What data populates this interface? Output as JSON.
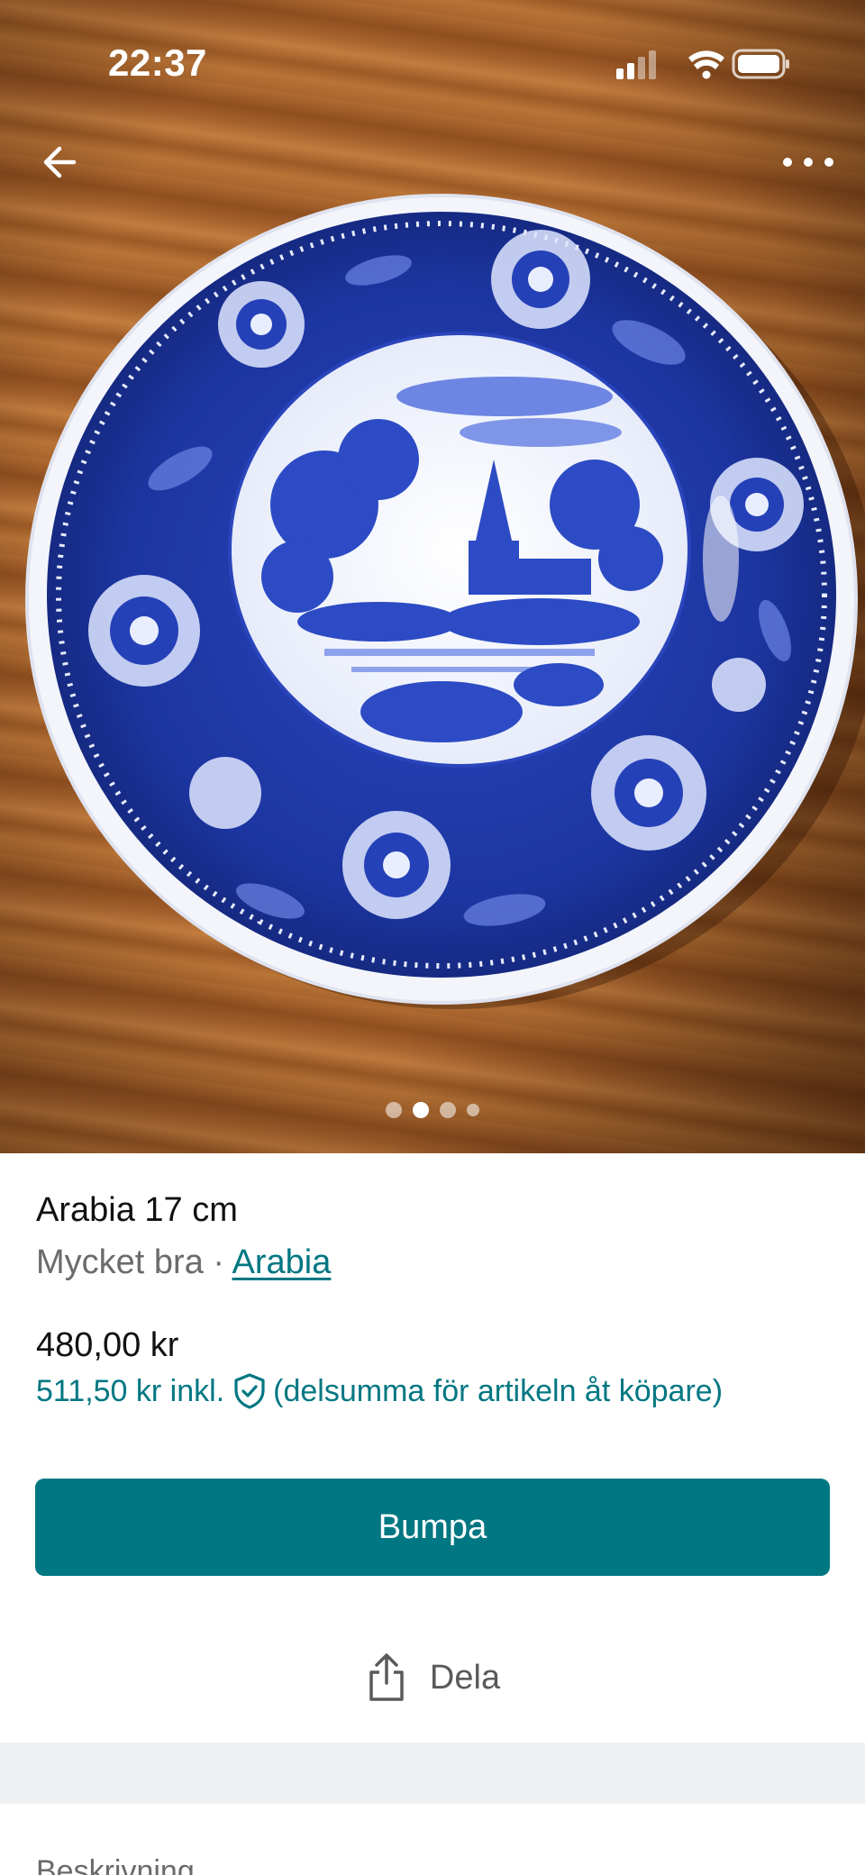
{
  "status_bar": {
    "time": "22:37",
    "icons": [
      "signal-icon",
      "wifi-icon",
      "battery-icon"
    ]
  },
  "nav": {
    "back_icon": "arrow-left-icon",
    "more_icon": "more-horizontal-icon"
  },
  "gallery": {
    "image_alt": "blue-and-white-plate-photo",
    "page_count": 4,
    "active_page": 2
  },
  "item": {
    "title": "Arabia 17 cm",
    "condition": "Mycket bra",
    "separator": " · ",
    "brand": "Arabia",
    "price": "480,00 kr",
    "price_incl": "511,50 kr inkl.",
    "price_incl_note": "(delsumma för artikeln åt köpare)"
  },
  "actions": {
    "bump_label": "Bumpa",
    "share_label": "Dela"
  },
  "description": {
    "section_label": "Beskrivning"
  },
  "colors": {
    "accent": "#007782",
    "plate_blue": "#1f3aa8",
    "wood": "#a8652d"
  }
}
